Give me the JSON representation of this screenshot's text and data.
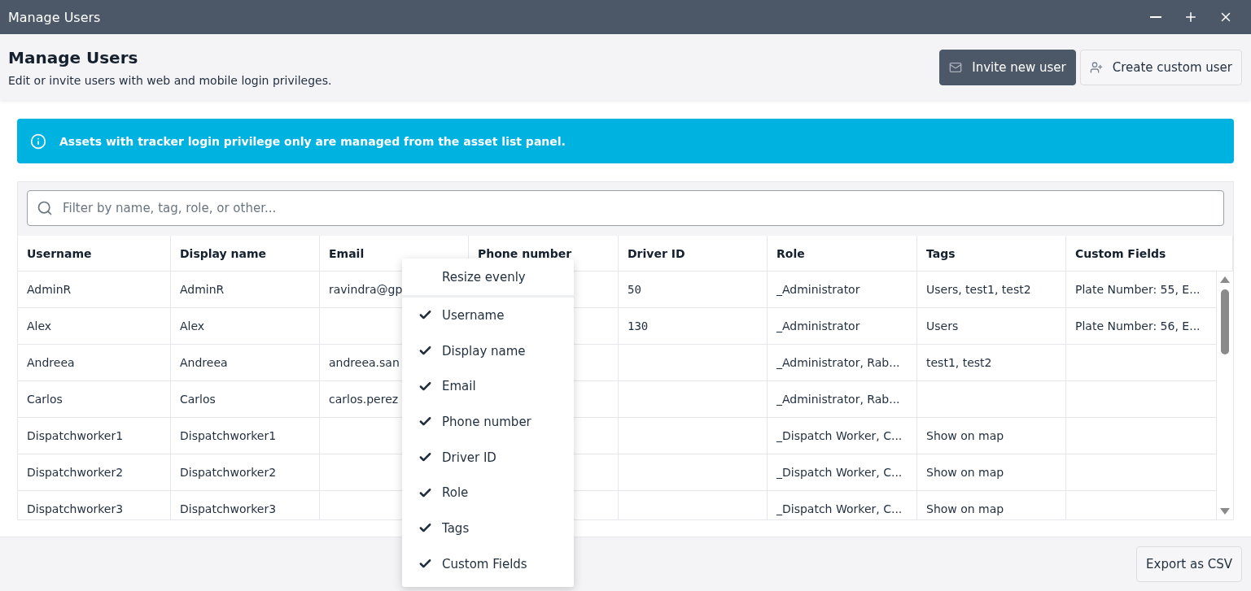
{
  "window": {
    "title": "Manage Users"
  },
  "header": {
    "title": "Manage Users",
    "subtitle": "Edit or invite users with web and mobile login privileges.",
    "buttons": [
      {
        "label": "Invite new user",
        "kind": "primary"
      },
      {
        "label": "Create custom user",
        "kind": "secondary"
      }
    ]
  },
  "banner": {
    "text": "Assets with tracker login privilege only are managed from the asset list panel."
  },
  "search": {
    "placeholder": "Filter by name, tag, role, or other..."
  },
  "table": {
    "columns": [
      "Username",
      "Display name",
      "Email",
      "Phone number",
      "Driver ID",
      "Role",
      "Tags",
      "Custom Fields"
    ],
    "rows": [
      [
        "AdminR",
        "AdminR",
        "ravindra@gp",
        "",
        "50",
        "_Administrator",
        "Users, test1, test2",
        "Plate Number: 55, E..."
      ],
      [
        "Alex",
        "Alex",
        "",
        "",
        "130",
        "_Administrator",
        "Users",
        "Plate Number: 56, E..."
      ],
      [
        "Andreea",
        "Andreea",
        "andreea.san",
        "",
        "",
        "_Administrator, Rab...",
        "test1, test2",
        ""
      ],
      [
        "Carlos",
        "Carlos",
        "carlos.perez",
        "",
        "",
        "_Administrator, Rab...",
        "",
        ""
      ],
      [
        "Dispatchworker1",
        "Dispatchworker1",
        "",
        "",
        "",
        "_Dispatch Worker, C...",
        "Show on map",
        ""
      ],
      [
        "Dispatchworker2",
        "Dispatchworker2",
        "",
        "",
        "",
        "_Dispatch Worker, C...",
        "Show on map",
        ""
      ],
      [
        "Dispatchworker3",
        "Dispatchworker3",
        "",
        "",
        "",
        "_Dispatch Worker, C...",
        "Show on map",
        ""
      ]
    ]
  },
  "column_menu": {
    "action": "Resize evenly",
    "items": [
      {
        "label": "Username",
        "checked": true
      },
      {
        "label": "Display name",
        "checked": true
      },
      {
        "label": "Email",
        "checked": true
      },
      {
        "label": "Phone number",
        "checked": true
      },
      {
        "label": "Driver ID",
        "checked": true
      },
      {
        "label": "Role",
        "checked": true
      },
      {
        "label": "Tags",
        "checked": true
      },
      {
        "label": "Custom Fields",
        "checked": true
      }
    ]
  },
  "footer": {
    "button": "Export as CSV"
  }
}
